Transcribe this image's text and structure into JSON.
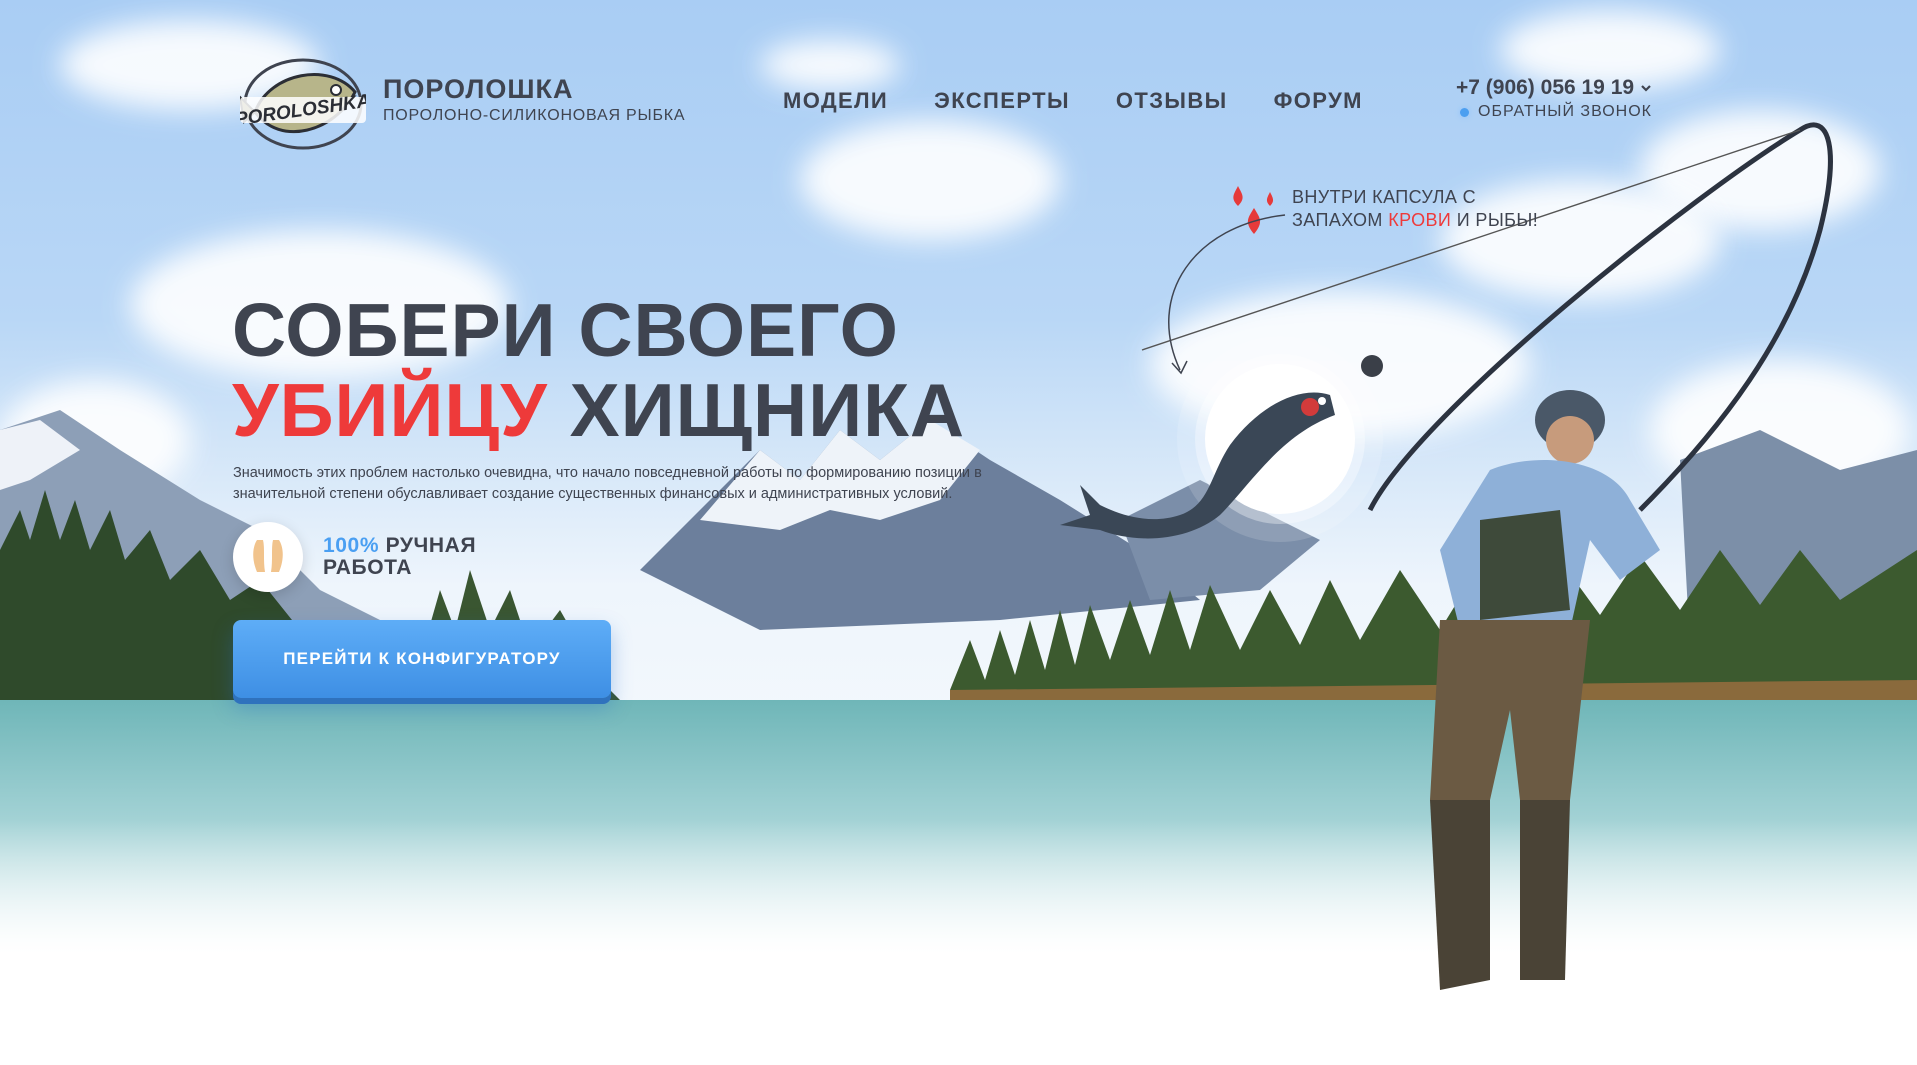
{
  "header": {
    "brand": {
      "logo_text": "POROLOSHKA",
      "name": "ПОРОЛОШКА",
      "subtitle": "ПОРОЛОНО-СИЛИКОНОВАЯ РЫБКА"
    },
    "nav": [
      {
        "label": "МОДЕЛИ"
      },
      {
        "label": "ЭКСПЕРТЫ"
      },
      {
        "label": "ОТЗЫВЫ"
      },
      {
        "label": "ФОРУМ"
      }
    ],
    "phone": "+7 (906) 056 19 19",
    "callback": "ОБРАТНЫЙ ЗВОНОК"
  },
  "hero": {
    "title_line1": "СОБЕРИ СВОЕГО",
    "title_red": "УБИЙЦУ",
    "title_rest": "ХИЩНИКА",
    "lead": "Значимость этих проблем настолько очевидна, что начало повседневной работы по формированию позиции в значительной степени обуславливает создание существенных финансовых и административных условий.",
    "badge_percent": "100%",
    "badge_text_a": "РУЧНАЯ",
    "badge_text_b": "РАБОТА",
    "cta_label": "ПЕРЕЙТИ К КОНФИГУРАТОРУ"
  },
  "callout": {
    "line1": "ВНУТРИ КАПСУЛА С",
    "line2_a": "ЗАПАХОМ",
    "line2_red": "КРОВИ",
    "line2_b": "И РЫБЫ!"
  },
  "colors": {
    "text": "#3f4450",
    "accent_red": "#ee3a3a",
    "accent_blue": "#4a9ff2"
  }
}
